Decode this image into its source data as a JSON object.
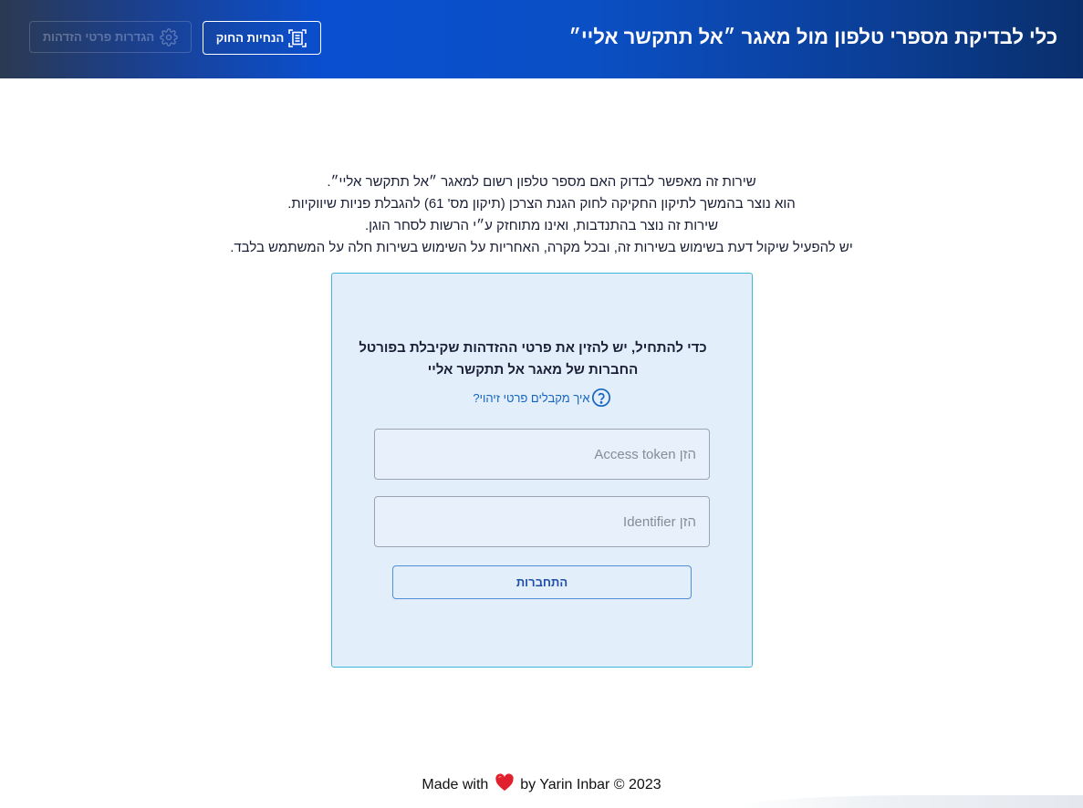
{
  "header": {
    "title": "כלי לבדיקת מספרי טלפון מול מאגר ״אל תתקשר אליי״",
    "law_button_label": "הנחיות החוק",
    "law_icon": "document-scan-icon",
    "settings_button_label": "הגדרות פרטי הזדהות",
    "settings_icon": "gear-icon"
  },
  "intro": {
    "lines": [
      "שירות זה מאפשר לבדוק האם מספר טלפון רשום למאגר ״אל תתקשר אליי״.",
      "הוא נוצר בהמשך לתיקון החקיקה לחוק הגנת הצרכן (תיקון מס' 61) להגבלת פניות שיווקיות.",
      "שירות זה נוצר בהתנדבות, ואינו מתוחזק ע״י הרשות לסחר הוגן.",
      "יש להפעיל שיקול דעת בשימוש בשירות זה, ובכל מקרה, האחריות על השימוש בשירות חלה על המשתמש בלבד."
    ]
  },
  "login": {
    "heading": "כדי להתחיל, יש להזין את פרטי ההזדהות שקיבלת בפורטל החברות של מאגר אל תתקשר אליי",
    "help_link": "איך מקבלים פרטי זיהוי?",
    "help_icon": "question-circle-icon",
    "access_token_placeholder": "הזן Access token",
    "access_token_value": "",
    "identifier_placeholder": "הזן Identifier",
    "identifier_value": "",
    "submit_label": "התחברות"
  },
  "footer": {
    "prefix": "Made with",
    "heart_icon": "heart-icon",
    "suffix": "by Yarin Inbar © 2023"
  },
  "colors": {
    "header_gradient_start": "#2b3a52",
    "header_gradient_mid": "#0a4fd0",
    "header_gradient_end": "#0a2f6b",
    "card_background": "#e3eefb",
    "card_border": "#3fb6dc",
    "link": "#1565c0",
    "heart": "#e0202c"
  }
}
